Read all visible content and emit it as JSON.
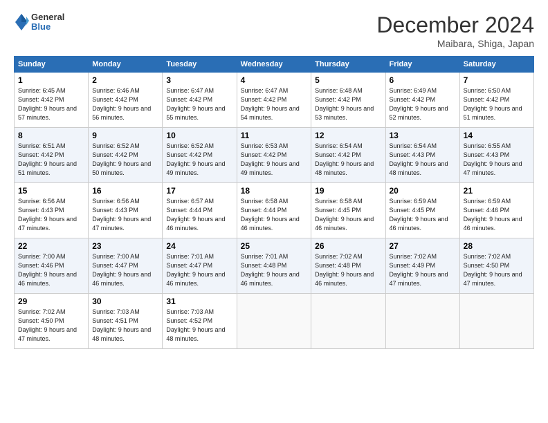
{
  "header": {
    "logo_general": "General",
    "logo_blue": "Blue",
    "month_title": "December 2024",
    "location": "Maibara, Shiga, Japan"
  },
  "weekdays": [
    "Sunday",
    "Monday",
    "Tuesday",
    "Wednesday",
    "Thursday",
    "Friday",
    "Saturday"
  ],
  "weeks": [
    [
      {
        "day": "1",
        "sunrise": "6:45 AM",
        "sunset": "4:42 PM",
        "daylight": "9 hours and 57 minutes."
      },
      {
        "day": "2",
        "sunrise": "6:46 AM",
        "sunset": "4:42 PM",
        "daylight": "9 hours and 56 minutes."
      },
      {
        "day": "3",
        "sunrise": "6:47 AM",
        "sunset": "4:42 PM",
        "daylight": "9 hours and 55 minutes."
      },
      {
        "day": "4",
        "sunrise": "6:47 AM",
        "sunset": "4:42 PM",
        "daylight": "9 hours and 54 minutes."
      },
      {
        "day": "5",
        "sunrise": "6:48 AM",
        "sunset": "4:42 PM",
        "daylight": "9 hours and 53 minutes."
      },
      {
        "day": "6",
        "sunrise": "6:49 AM",
        "sunset": "4:42 PM",
        "daylight": "9 hours and 52 minutes."
      },
      {
        "day": "7",
        "sunrise": "6:50 AM",
        "sunset": "4:42 PM",
        "daylight": "9 hours and 51 minutes."
      }
    ],
    [
      {
        "day": "8",
        "sunrise": "6:51 AM",
        "sunset": "4:42 PM",
        "daylight": "9 hours and 51 minutes."
      },
      {
        "day": "9",
        "sunrise": "6:52 AM",
        "sunset": "4:42 PM",
        "daylight": "9 hours and 50 minutes."
      },
      {
        "day": "10",
        "sunrise": "6:52 AM",
        "sunset": "4:42 PM",
        "daylight": "9 hours and 49 minutes."
      },
      {
        "day": "11",
        "sunrise": "6:53 AM",
        "sunset": "4:42 PM",
        "daylight": "9 hours and 49 minutes."
      },
      {
        "day": "12",
        "sunrise": "6:54 AM",
        "sunset": "4:42 PM",
        "daylight": "9 hours and 48 minutes."
      },
      {
        "day": "13",
        "sunrise": "6:54 AM",
        "sunset": "4:43 PM",
        "daylight": "9 hours and 48 minutes."
      },
      {
        "day": "14",
        "sunrise": "6:55 AM",
        "sunset": "4:43 PM",
        "daylight": "9 hours and 47 minutes."
      }
    ],
    [
      {
        "day": "15",
        "sunrise": "6:56 AM",
        "sunset": "4:43 PM",
        "daylight": "9 hours and 47 minutes."
      },
      {
        "day": "16",
        "sunrise": "6:56 AM",
        "sunset": "4:43 PM",
        "daylight": "9 hours and 47 minutes."
      },
      {
        "day": "17",
        "sunrise": "6:57 AM",
        "sunset": "4:44 PM",
        "daylight": "9 hours and 46 minutes."
      },
      {
        "day": "18",
        "sunrise": "6:58 AM",
        "sunset": "4:44 PM",
        "daylight": "9 hours and 46 minutes."
      },
      {
        "day": "19",
        "sunrise": "6:58 AM",
        "sunset": "4:45 PM",
        "daylight": "9 hours and 46 minutes."
      },
      {
        "day": "20",
        "sunrise": "6:59 AM",
        "sunset": "4:45 PM",
        "daylight": "9 hours and 46 minutes."
      },
      {
        "day": "21",
        "sunrise": "6:59 AM",
        "sunset": "4:46 PM",
        "daylight": "9 hours and 46 minutes."
      }
    ],
    [
      {
        "day": "22",
        "sunrise": "7:00 AM",
        "sunset": "4:46 PM",
        "daylight": "9 hours and 46 minutes."
      },
      {
        "day": "23",
        "sunrise": "7:00 AM",
        "sunset": "4:47 PM",
        "daylight": "9 hours and 46 minutes."
      },
      {
        "day": "24",
        "sunrise": "7:01 AM",
        "sunset": "4:47 PM",
        "daylight": "9 hours and 46 minutes."
      },
      {
        "day": "25",
        "sunrise": "7:01 AM",
        "sunset": "4:48 PM",
        "daylight": "9 hours and 46 minutes."
      },
      {
        "day": "26",
        "sunrise": "7:02 AM",
        "sunset": "4:48 PM",
        "daylight": "9 hours and 46 minutes."
      },
      {
        "day": "27",
        "sunrise": "7:02 AM",
        "sunset": "4:49 PM",
        "daylight": "9 hours and 47 minutes."
      },
      {
        "day": "28",
        "sunrise": "7:02 AM",
        "sunset": "4:50 PM",
        "daylight": "9 hours and 47 minutes."
      }
    ],
    [
      {
        "day": "29",
        "sunrise": "7:02 AM",
        "sunset": "4:50 PM",
        "daylight": "9 hours and 47 minutes."
      },
      {
        "day": "30",
        "sunrise": "7:03 AM",
        "sunset": "4:51 PM",
        "daylight": "9 hours and 48 minutes."
      },
      {
        "day": "31",
        "sunrise": "7:03 AM",
        "sunset": "4:52 PM",
        "daylight": "9 hours and 48 minutes."
      },
      null,
      null,
      null,
      null
    ]
  ]
}
